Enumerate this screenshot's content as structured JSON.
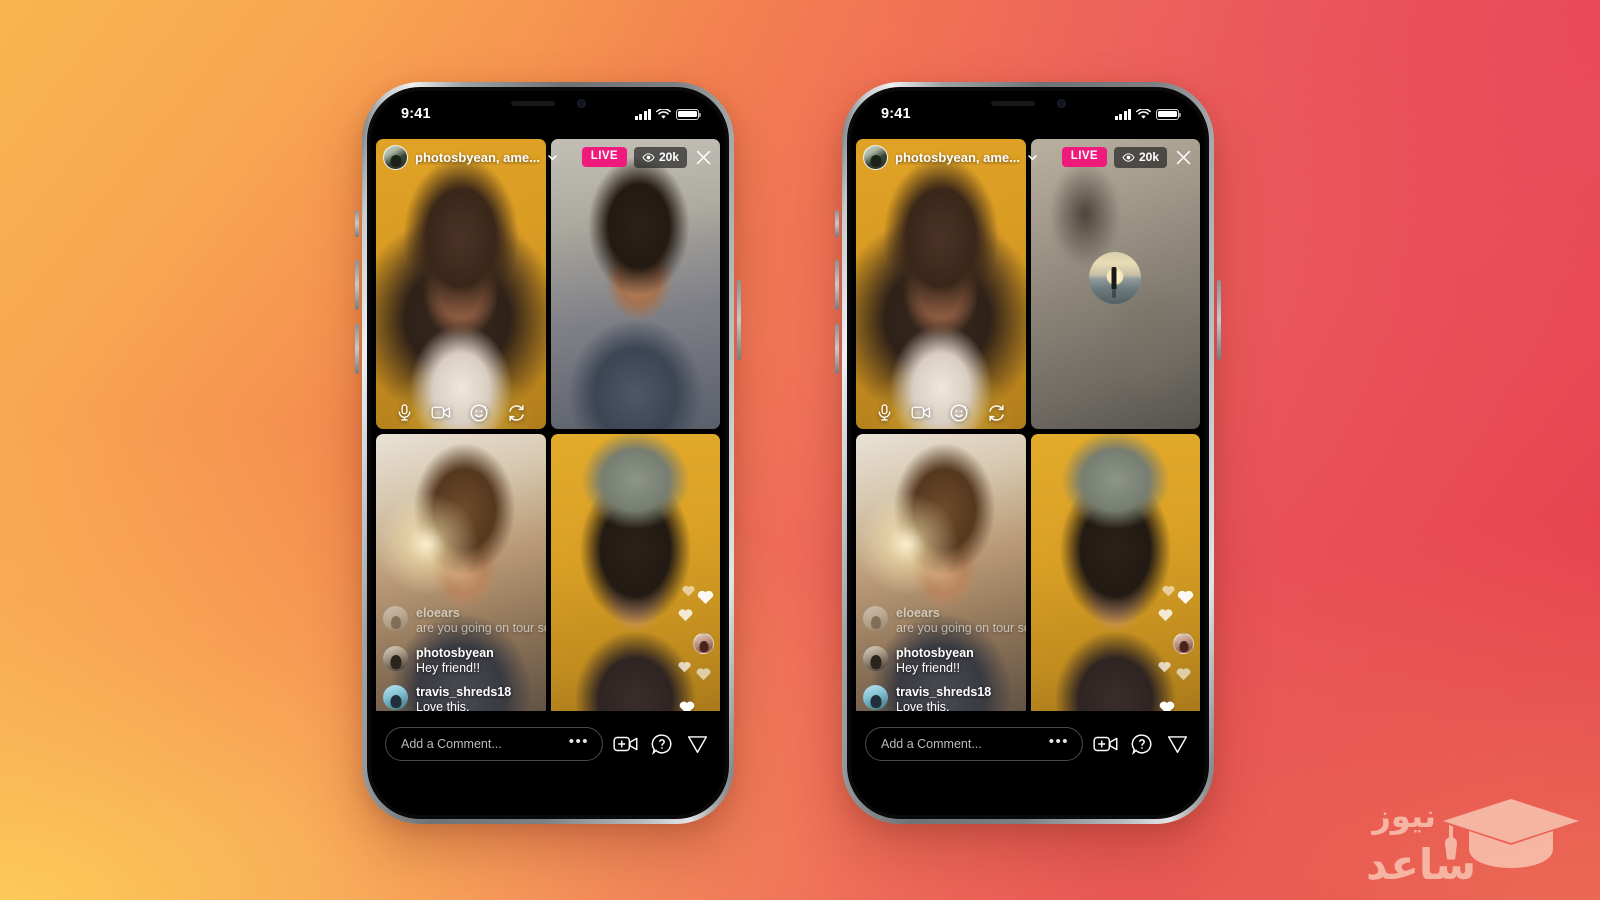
{
  "background": {
    "top_left_color": "#F7B653",
    "top_right_color": "#E8495A",
    "bottom_left_color": "#FDCB58",
    "bottom_right_color": "#F08457"
  },
  "phones": [
    {
      "id": "phone-left",
      "status_bar": {
        "time": "9:41",
        "signal_icon": "cellular-bars-icon",
        "wifi_icon": "wifi-icon",
        "battery_icon": "battery-icon"
      },
      "header": {
        "avatar_icon": "host-avatar",
        "title": "photosbyean, ame...",
        "chevron_icon": "chevron-down-icon",
        "live_label": "LIVE",
        "viewer_icon": "eye-icon",
        "viewer_count": "20k",
        "close_icon": "close-icon"
      },
      "tiles": [
        {
          "name": "tile-host-video",
          "state": "live",
          "controls": [
            "microphone-icon",
            "video-camera-icon",
            "effects-smiley-icon",
            "flip-camera-icon"
          ]
        },
        {
          "name": "tile-guest-1-video",
          "state": "live",
          "controls": []
        },
        {
          "name": "tile-guest-2-video",
          "state": "live",
          "controls": []
        },
        {
          "name": "tile-guest-3-video",
          "state": "live",
          "controls": []
        }
      ],
      "comments": [
        {
          "user": "eloears",
          "text": "are you going on tour soon?",
          "faded": true
        },
        {
          "user": "photosbyean",
          "text": "Hey friend!!",
          "faded": false
        },
        {
          "user": "travis_shreds18",
          "text": "Love this.",
          "faded": false
        }
      ],
      "bottom_bar": {
        "input_placeholder": "Add a Comment...",
        "input_value": "",
        "more_icon": "more-dots-icon",
        "actions": [
          "add-video-guest-icon",
          "questions-icon",
          "share-send-icon"
        ]
      },
      "home_indicator": "home-indicator"
    },
    {
      "id": "phone-right",
      "status_bar": {
        "time": "9:41",
        "signal_icon": "cellular-bars-icon",
        "wifi_icon": "wifi-icon",
        "battery_icon": "battery-icon"
      },
      "header": {
        "avatar_icon": "host-avatar",
        "title": "photosbyean, ame...",
        "chevron_icon": "chevron-down-icon",
        "live_label": "LIVE",
        "viewer_icon": "eye-icon",
        "viewer_count": "20k",
        "close_icon": "close-icon"
      },
      "tiles": [
        {
          "name": "tile-host-video",
          "state": "live",
          "controls": [
            "microphone-icon",
            "video-camera-icon",
            "effects-smiley-icon",
            "flip-camera-icon"
          ]
        },
        {
          "name": "tile-guest-waiting",
          "state": "blurred-waiting",
          "controls": []
        },
        {
          "name": "tile-guest-2-video",
          "state": "live",
          "controls": []
        },
        {
          "name": "tile-guest-3-video",
          "state": "live",
          "controls": []
        }
      ],
      "comments": [
        {
          "user": "eloears",
          "text": "are you going on tour soon?",
          "faded": true
        },
        {
          "user": "photosbyean",
          "text": "Hey friend!!",
          "faded": false
        },
        {
          "user": "travis_shreds18",
          "text": "Love this.",
          "faded": false
        }
      ],
      "bottom_bar": {
        "input_placeholder": "Add a Comment...",
        "input_value": "",
        "more_icon": "more-dots-icon",
        "actions": [
          "add-video-guest-icon",
          "questions-icon",
          "share-send-icon"
        ]
      },
      "home_indicator": "home-indicator"
    }
  ],
  "theme": {
    "live_badge_color": "#EE1B7C",
    "viewer_pill_color": "rgba(40,40,40,0.72)",
    "screen_background": "#000000"
  },
  "watermark": {
    "line1": "نیوز",
    "line2": "ساعد",
    "icon": "graduation-cap-icon"
  }
}
